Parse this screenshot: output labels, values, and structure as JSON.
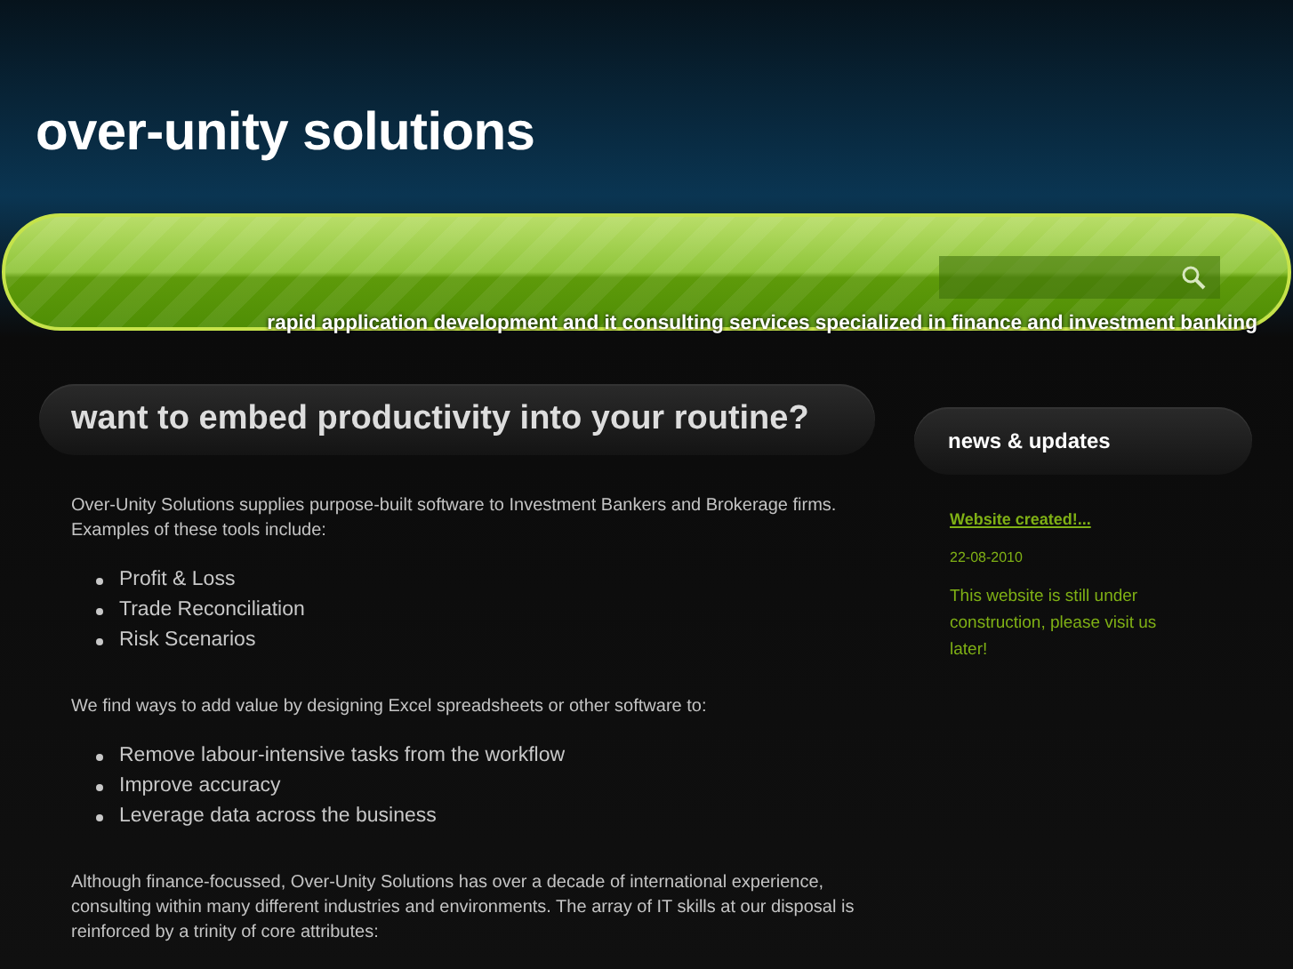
{
  "site_title": "over-unity solutions",
  "tagline": "rapid application development and it consulting services specialized in finance and investment banking",
  "main": {
    "heading": "want to embed productivity into your routine?",
    "blocks": [
      {
        "kind": "paragraph",
        "text": "Over-Unity Solutions supplies purpose-built software to Investment Bankers and Brokerage firms. Examples of these tools include:"
      },
      {
        "kind": "list",
        "items": [
          "Profit & Loss",
          "Trade Reconciliation",
          "Risk Scenarios"
        ]
      },
      {
        "kind": "paragraph",
        "text": "We find ways to add value by designing Excel spreadsheets or other software to:"
      },
      {
        "kind": "list",
        "items": [
          "Remove labour-intensive tasks from the workflow",
          "Improve accuracy",
          "Leverage data across the business"
        ]
      },
      {
        "kind": "paragraph",
        "text": "Although finance-focussed, Over-Unity Solutions has over a decade of international experience, consulting within many different industries and environments. The array of IT skills at our disposal is reinforced by a trinity of core attributes:"
      }
    ]
  },
  "sidebar": {
    "heading": "news & updates",
    "news": [
      {
        "title": "Website created!...",
        "date": "22-08-2010",
        "text": "This website is still under construction, please visit us later!"
      }
    ]
  }
}
